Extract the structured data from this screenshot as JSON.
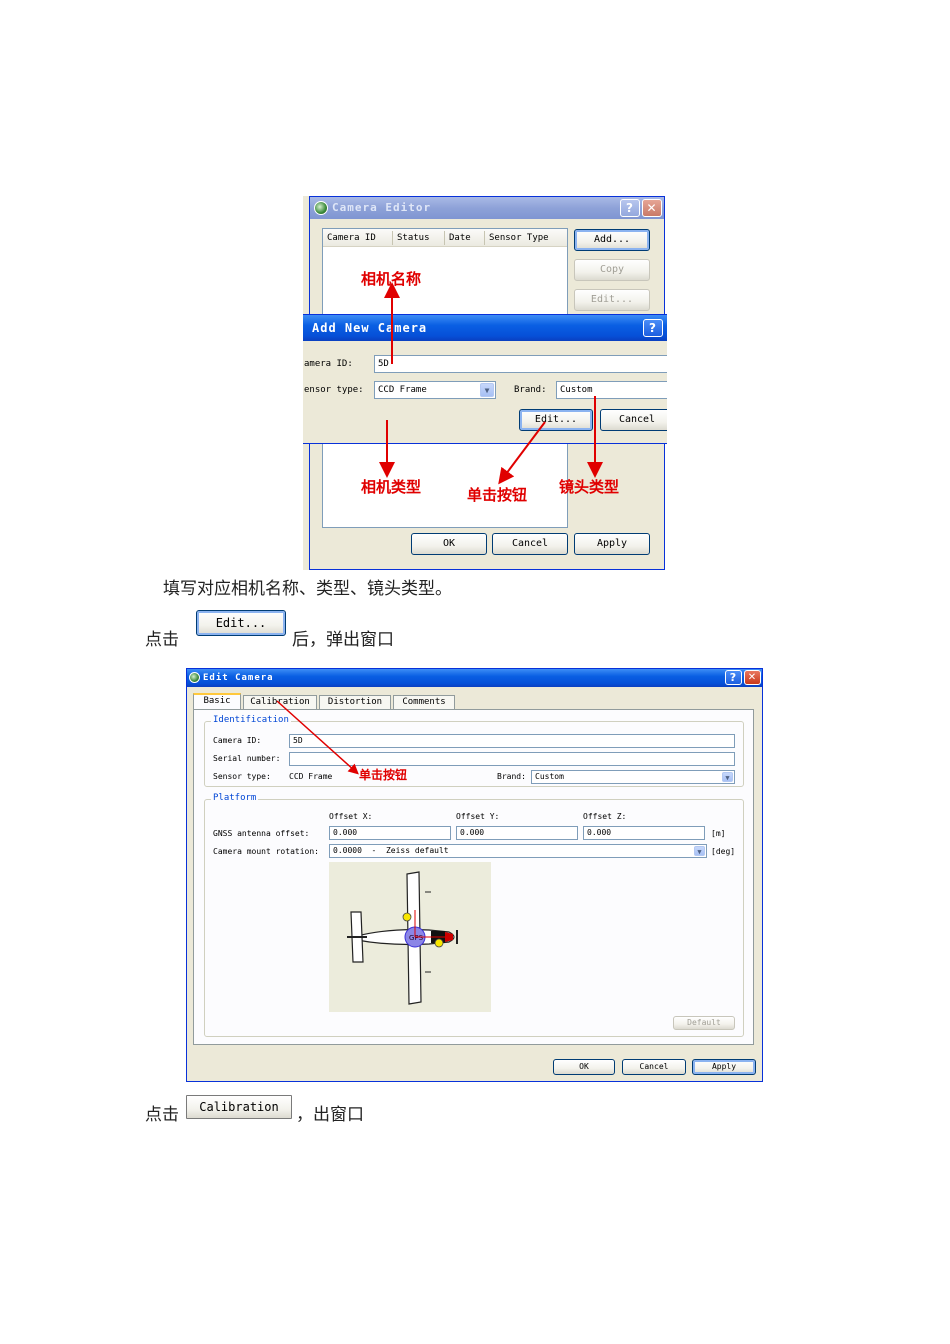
{
  "camera_editor": {
    "title": "Camera Editor",
    "columns": [
      "Camera ID",
      "Status",
      "Date",
      "Sensor Type"
    ],
    "add_button": "Add...",
    "copy_button": "Copy",
    "edit_button": "Edit...",
    "ok_button": "OK",
    "cancel_button": "Cancel",
    "apply_button": "Apply"
  },
  "add_new_camera": {
    "title": "Add New Camera",
    "camera_id_label": "amera ID:",
    "camera_id_value": "5D",
    "sensor_type_label": "ensor type:",
    "sensor_type_value": "CCD Frame",
    "brand_label": "Brand:",
    "brand_value": "Custom",
    "edit_button": "Edit...",
    "cancel_button": "Cancel"
  },
  "annotations_top": {
    "camera_name": "相机名称",
    "camera_type": "相机类型",
    "click_button": "单击按钮",
    "lens_type": "镜头类型"
  },
  "text": {
    "line1": "填写对应相机名称、类型、镜头类型。",
    "line2_prefix": "点击",
    "line2_suffix": "后，弹出窗口",
    "line3_prefix": "点击",
    "line3_suffix": "，出窗口"
  },
  "inline_buttons": {
    "edit": "Edit...",
    "calibration": "Calibration"
  },
  "edit_camera": {
    "title": "Edit Camera",
    "tabs": [
      "Basic",
      "Calibration",
      "Distortion",
      "Comments"
    ],
    "identification": {
      "title": "Identification",
      "camera_id_label": "Camera ID:",
      "camera_id_value": "5D",
      "serial_label": "Serial number:",
      "serial_value": "",
      "sensor_label": "Sensor type:",
      "sensor_value": "CCD Frame",
      "brand_label": "Brand:",
      "brand_value": "Custom"
    },
    "platform": {
      "title": "Platform",
      "offset_x_label": "Offset X:",
      "offset_y_label": "Offset Y:",
      "offset_z_label": "Offset Z:",
      "gnss_label": "GNSS antenna offset:",
      "offset_x": "0.000",
      "offset_y": "0.000",
      "offset_z": "0.000",
      "unit_m": "[m]",
      "mount_label": "Camera mount rotation:",
      "mount_value": "0.0000  -  Zeiss default",
      "unit_deg": "[deg]",
      "gps_label": "GPS",
      "default_button": "Default"
    },
    "annotation": "单击按钮",
    "ok_button": "OK",
    "cancel_button": "Cancel",
    "apply_button": "Apply"
  }
}
